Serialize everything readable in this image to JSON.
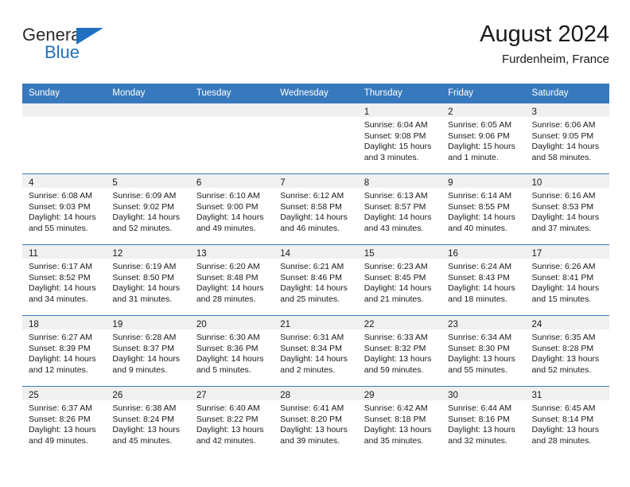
{
  "brand": {
    "general": "General",
    "blue": "Blue",
    "triangle_color": "#1f70c1",
    "general_color": "#2b2b2b"
  },
  "header": {
    "title": "August 2024",
    "subtitle": "Furdenheim, France",
    "header_bg": "#3879bd",
    "daynum_bg": "#f0f0f0"
  },
  "weekdays": [
    "Sunday",
    "Monday",
    "Tuesday",
    "Wednesday",
    "Thursday",
    "Friday",
    "Saturday"
  ],
  "weeks": [
    [
      {
        "day": "",
        "lines": []
      },
      {
        "day": "",
        "lines": []
      },
      {
        "day": "",
        "lines": []
      },
      {
        "day": "",
        "lines": []
      },
      {
        "day": "1",
        "lines": [
          "Sunrise: 6:04 AM",
          "Sunset: 9:08 PM",
          "Daylight: 15 hours",
          "and 3 minutes."
        ]
      },
      {
        "day": "2",
        "lines": [
          "Sunrise: 6:05 AM",
          "Sunset: 9:06 PM",
          "Daylight: 15 hours",
          "and 1 minute."
        ]
      },
      {
        "day": "3",
        "lines": [
          "Sunrise: 6:06 AM",
          "Sunset: 9:05 PM",
          "Daylight: 14 hours",
          "and 58 minutes."
        ]
      }
    ],
    [
      {
        "day": "4",
        "lines": [
          "Sunrise: 6:08 AM",
          "Sunset: 9:03 PM",
          "Daylight: 14 hours",
          "and 55 minutes."
        ]
      },
      {
        "day": "5",
        "lines": [
          "Sunrise: 6:09 AM",
          "Sunset: 9:02 PM",
          "Daylight: 14 hours",
          "and 52 minutes."
        ]
      },
      {
        "day": "6",
        "lines": [
          "Sunrise: 6:10 AM",
          "Sunset: 9:00 PM",
          "Daylight: 14 hours",
          "and 49 minutes."
        ]
      },
      {
        "day": "7",
        "lines": [
          "Sunrise: 6:12 AM",
          "Sunset: 8:58 PM",
          "Daylight: 14 hours",
          "and 46 minutes."
        ]
      },
      {
        "day": "8",
        "lines": [
          "Sunrise: 6:13 AM",
          "Sunset: 8:57 PM",
          "Daylight: 14 hours",
          "and 43 minutes."
        ]
      },
      {
        "day": "9",
        "lines": [
          "Sunrise: 6:14 AM",
          "Sunset: 8:55 PM",
          "Daylight: 14 hours",
          "and 40 minutes."
        ]
      },
      {
        "day": "10",
        "lines": [
          "Sunrise: 6:16 AM",
          "Sunset: 8:53 PM",
          "Daylight: 14 hours",
          "and 37 minutes."
        ]
      }
    ],
    [
      {
        "day": "11",
        "lines": [
          "Sunrise: 6:17 AM",
          "Sunset: 8:52 PM",
          "Daylight: 14 hours",
          "and 34 minutes."
        ]
      },
      {
        "day": "12",
        "lines": [
          "Sunrise: 6:19 AM",
          "Sunset: 8:50 PM",
          "Daylight: 14 hours",
          "and 31 minutes."
        ]
      },
      {
        "day": "13",
        "lines": [
          "Sunrise: 6:20 AM",
          "Sunset: 8:48 PM",
          "Daylight: 14 hours",
          "and 28 minutes."
        ]
      },
      {
        "day": "14",
        "lines": [
          "Sunrise: 6:21 AM",
          "Sunset: 8:46 PM",
          "Daylight: 14 hours",
          "and 25 minutes."
        ]
      },
      {
        "day": "15",
        "lines": [
          "Sunrise: 6:23 AM",
          "Sunset: 8:45 PM",
          "Daylight: 14 hours",
          "and 21 minutes."
        ]
      },
      {
        "day": "16",
        "lines": [
          "Sunrise: 6:24 AM",
          "Sunset: 8:43 PM",
          "Daylight: 14 hours",
          "and 18 minutes."
        ]
      },
      {
        "day": "17",
        "lines": [
          "Sunrise: 6:26 AM",
          "Sunset: 8:41 PM",
          "Daylight: 14 hours",
          "and 15 minutes."
        ]
      }
    ],
    [
      {
        "day": "18",
        "lines": [
          "Sunrise: 6:27 AM",
          "Sunset: 8:39 PM",
          "Daylight: 14 hours",
          "and 12 minutes."
        ]
      },
      {
        "day": "19",
        "lines": [
          "Sunrise: 6:28 AM",
          "Sunset: 8:37 PM",
          "Daylight: 14 hours",
          "and 9 minutes."
        ]
      },
      {
        "day": "20",
        "lines": [
          "Sunrise: 6:30 AM",
          "Sunset: 8:36 PM",
          "Daylight: 14 hours",
          "and 5 minutes."
        ]
      },
      {
        "day": "21",
        "lines": [
          "Sunrise: 6:31 AM",
          "Sunset: 8:34 PM",
          "Daylight: 14 hours",
          "and 2 minutes."
        ]
      },
      {
        "day": "22",
        "lines": [
          "Sunrise: 6:33 AM",
          "Sunset: 8:32 PM",
          "Daylight: 13 hours",
          "and 59 minutes."
        ]
      },
      {
        "day": "23",
        "lines": [
          "Sunrise: 6:34 AM",
          "Sunset: 8:30 PM",
          "Daylight: 13 hours",
          "and 55 minutes."
        ]
      },
      {
        "day": "24",
        "lines": [
          "Sunrise: 6:35 AM",
          "Sunset: 8:28 PM",
          "Daylight: 13 hours",
          "and 52 minutes."
        ]
      }
    ],
    [
      {
        "day": "25",
        "lines": [
          "Sunrise: 6:37 AM",
          "Sunset: 8:26 PM",
          "Daylight: 13 hours",
          "and 49 minutes."
        ]
      },
      {
        "day": "26",
        "lines": [
          "Sunrise: 6:38 AM",
          "Sunset: 8:24 PM",
          "Daylight: 13 hours",
          "and 45 minutes."
        ]
      },
      {
        "day": "27",
        "lines": [
          "Sunrise: 6:40 AM",
          "Sunset: 8:22 PM",
          "Daylight: 13 hours",
          "and 42 minutes."
        ]
      },
      {
        "day": "28",
        "lines": [
          "Sunrise: 6:41 AM",
          "Sunset: 8:20 PM",
          "Daylight: 13 hours",
          "and 39 minutes."
        ]
      },
      {
        "day": "29",
        "lines": [
          "Sunrise: 6:42 AM",
          "Sunset: 8:18 PM",
          "Daylight: 13 hours",
          "and 35 minutes."
        ]
      },
      {
        "day": "30",
        "lines": [
          "Sunrise: 6:44 AM",
          "Sunset: 8:16 PM",
          "Daylight: 13 hours",
          "and 32 minutes."
        ]
      },
      {
        "day": "31",
        "lines": [
          "Sunrise: 6:45 AM",
          "Sunset: 8:14 PM",
          "Daylight: 13 hours",
          "and 28 minutes."
        ]
      }
    ]
  ]
}
